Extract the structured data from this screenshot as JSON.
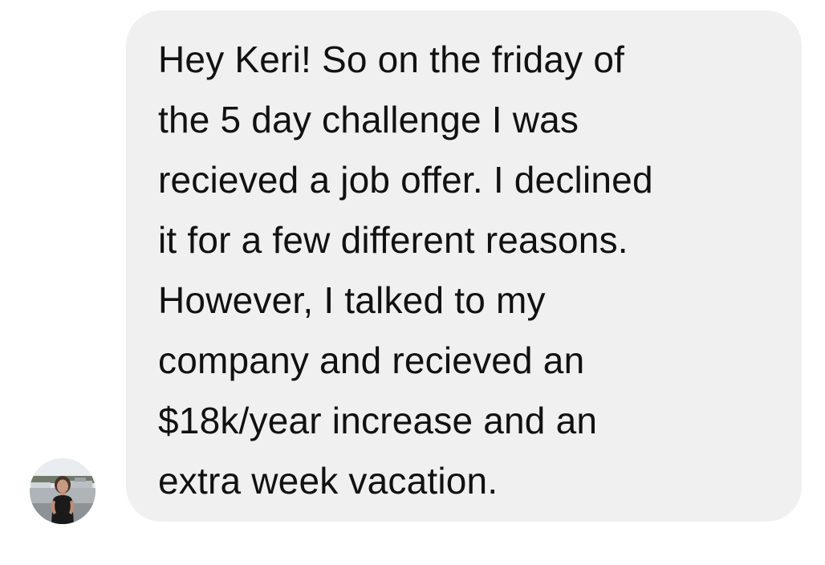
{
  "message": {
    "lines": [
      "Hey Keri! So on the friday of",
      "the 5 day challenge I was",
      "recieved a job offer. I declined",
      "it for a few different reasons.",
      "However, I talked to my",
      "company and recieved an",
      "$18k/year increase and an",
      "extra week vacation."
    ]
  },
  "sender": {
    "avatar_icon": "avatar-photo"
  },
  "colors": {
    "bubble_bg": "#f0f0f0",
    "text": "#111111",
    "page_bg": "#ffffff"
  }
}
